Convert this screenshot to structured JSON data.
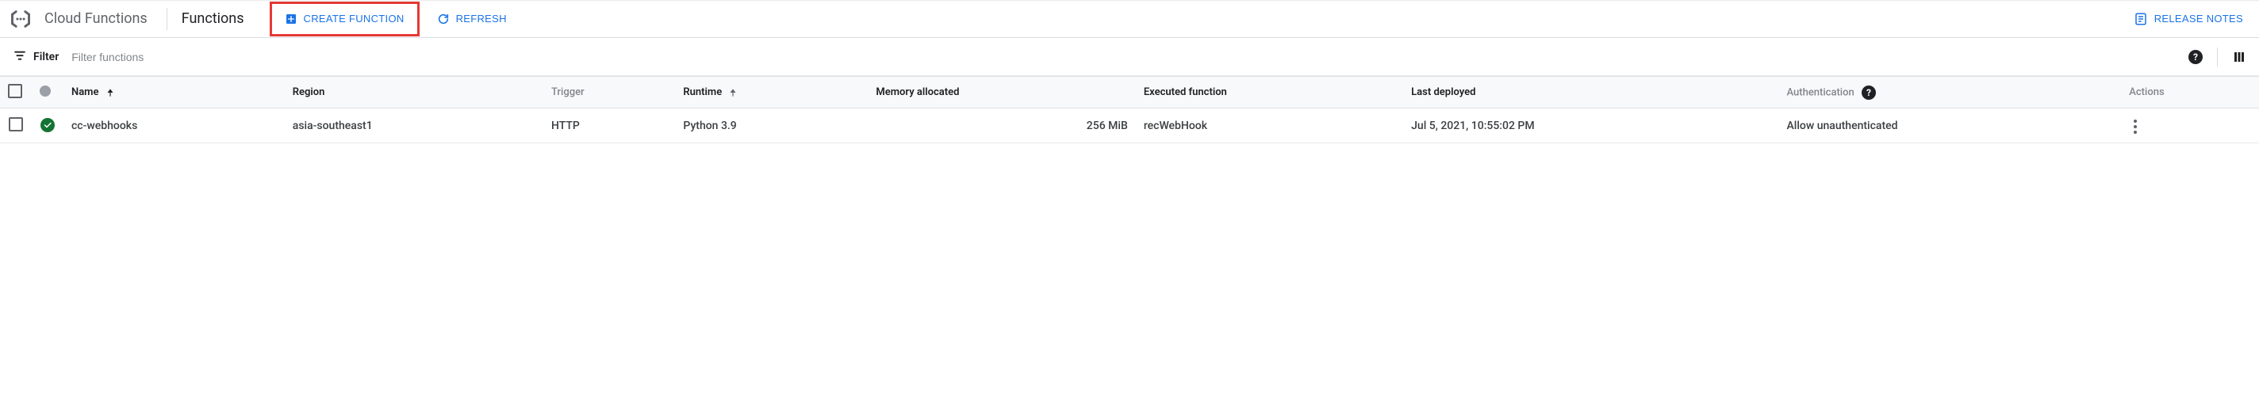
{
  "header": {
    "product": "Cloud Functions",
    "page": "Functions",
    "create_label": "CREATE FUNCTION",
    "refresh_label": "REFRESH",
    "release_notes_label": "RELEASE NOTES"
  },
  "filter": {
    "label": "Filter",
    "placeholder": "Filter functions"
  },
  "table": {
    "columns": {
      "name": "Name",
      "region": "Region",
      "trigger": "Trigger",
      "runtime": "Runtime",
      "memory": "Memory allocated",
      "executed": "Executed function",
      "deployed": "Last deployed",
      "auth": "Authentication",
      "actions": "Actions"
    },
    "rows": [
      {
        "status": "ok",
        "name": "cc-webhooks",
        "region": "asia-southeast1",
        "trigger": "HTTP",
        "runtime": "Python 3.9",
        "memory": "256 MiB",
        "executed": "recWebHook",
        "deployed": "Jul 5, 2021, 10:55:02 PM",
        "auth": "Allow unauthenticated"
      }
    ]
  }
}
